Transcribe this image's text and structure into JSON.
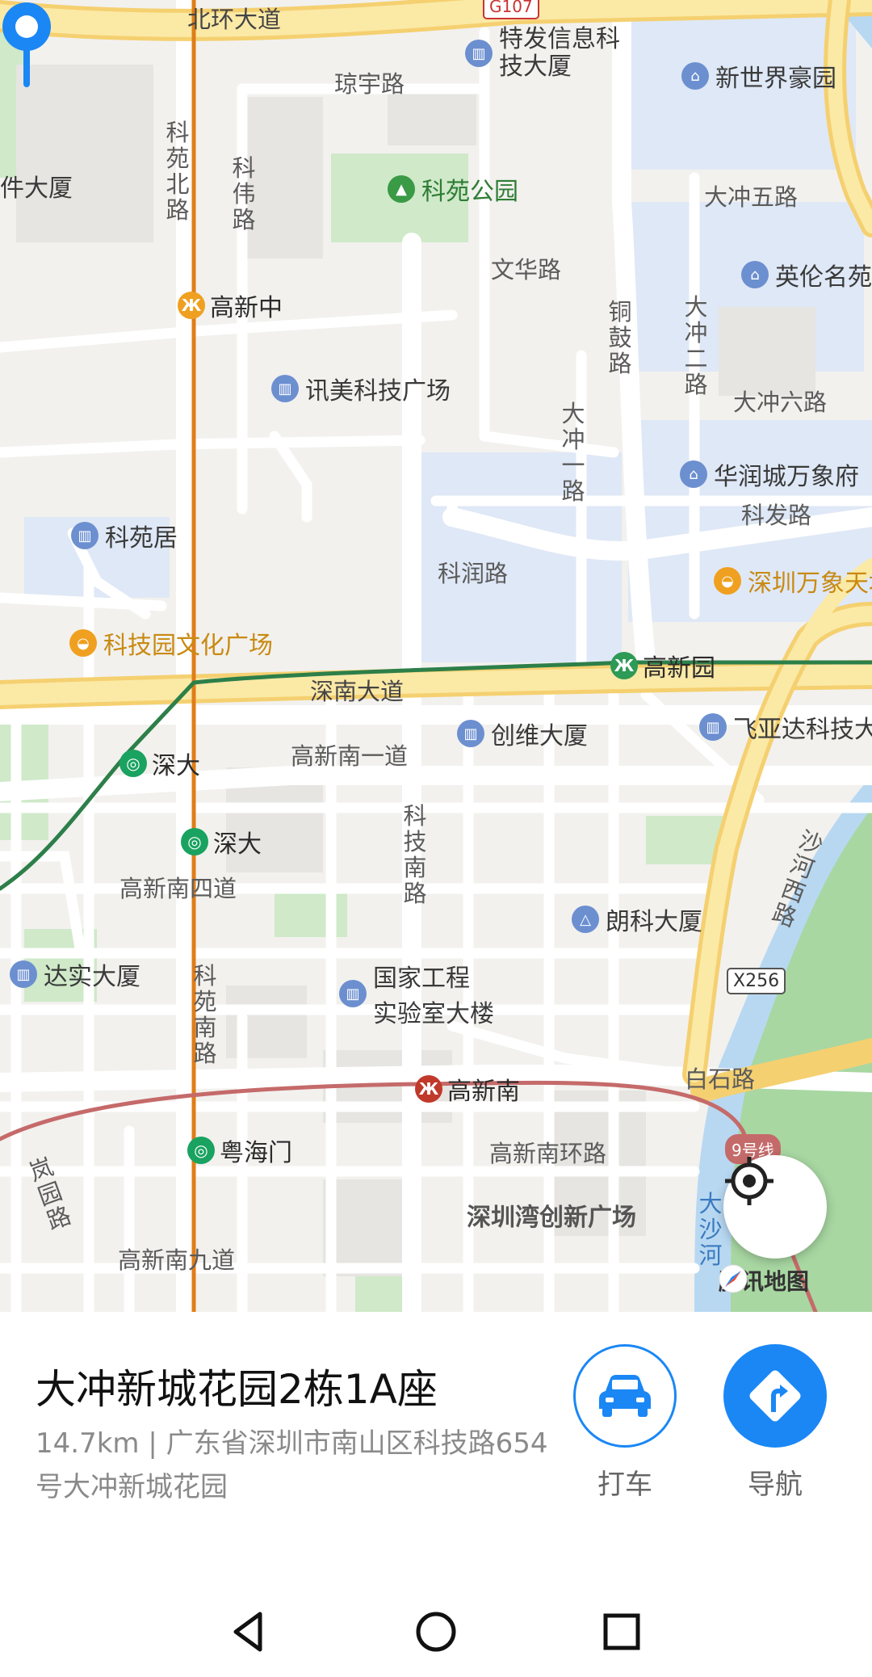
{
  "map": {
    "roads": {
      "beihuan": "北环大道",
      "qiongyu": "琼宇路",
      "keyuan_north": "科苑北路",
      "kewei": "科伟路",
      "wenhua": "文华路",
      "tonggu": "铜鼓路",
      "dachong_er": "大冲二路",
      "dachong_wu": "大冲五路",
      "dachong_liu": "大冲六路",
      "dachong_yi": "大冲一路",
      "kefa": "科发路",
      "kerun": "科润路",
      "shennan": "深南大道",
      "gaoxin_nan_yi": "高新南一道",
      "keji_nan": "科技南路",
      "gaoxin_nan_si": "高新南四道",
      "shahe_xi": "沙河西路",
      "keyuan_nan": "科苑南路",
      "baishi": "白石路",
      "gaoxin_nan_huan": "高新南环路",
      "lanyuan": "岚园路",
      "gaoxin_nan_jiu": "高新南九道",
      "dashahe": "大沙河"
    },
    "shields": {
      "g107": "G107",
      "x256": "X256",
      "line9": "9号线"
    },
    "pois": {
      "tefa": "特发信息科技大厦",
      "xinshijie": "新世界豪园",
      "jiandasha": "件大厦",
      "keyuan_park": "科苑公园",
      "yinglun": "英伦名苑",
      "xunmei": "讯美科技广场",
      "huarun": "华润城万象府",
      "keyuanju": "科苑居",
      "wanxiangtian": "深圳万象天地",
      "wenhua_plaza": "科技园文化广场",
      "chuangwei": "创维大厦",
      "feiyada": "飞亚达科技大厦",
      "langke": "朗科大厦",
      "dashi": "达实大厦",
      "guojia_l1": "国家工程",
      "guojia_l2": "实验室大楼",
      "wanchuang": "深圳湾创新广场"
    },
    "metro": {
      "gaoxinzhong": "高新中",
      "gaoxinyuan": "高新园",
      "shenda1": "深大",
      "shenda2": "深大",
      "gaoxinnan": "高新南",
      "yuehaimen": "粤海门"
    },
    "logo": "腾讯地图"
  },
  "card": {
    "title": "大冲新城花园2栋1A座",
    "subtitle": "14.7km | 广东省深圳市南山区科技路654号大冲新城花园",
    "taxi_label": "打车",
    "nav_label": "导航"
  },
  "colors": {
    "accent": "#1a87f5",
    "metro_orange": "#f0a020",
    "metro_green": "#1aa260",
    "metro_red": "#c0392b"
  }
}
